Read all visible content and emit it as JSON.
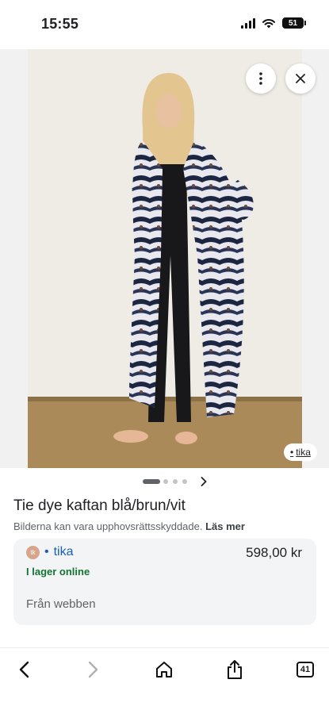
{
  "status_bar": {
    "time": "15:55",
    "battery": "51"
  },
  "image": {
    "merchant_chip": "tika"
  },
  "carousel": {
    "next_icon": "chevron-right-icon"
  },
  "product": {
    "title": "Tie dye kaftan blå/brun/vit",
    "copyright_text": "Bilderna kan vara upphovsrättsskyddade.",
    "learn_more": "Läs mer"
  },
  "offer": {
    "seller": "tika",
    "seller_logo_text": "tk",
    "price": "598,00 kr",
    "stock": "I lager online",
    "source": "Från webben"
  },
  "toolbar": {
    "tabs_count": "41"
  },
  "colors": {
    "seller_link": "#1a5fb4",
    "in_stock": "#137333",
    "card_bg": "#f3f4f6"
  }
}
